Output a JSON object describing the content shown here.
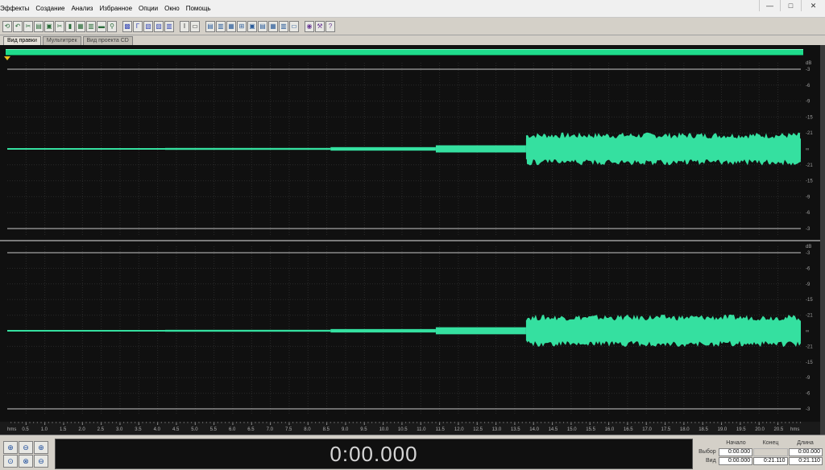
{
  "menu": [
    "Эффекты",
    "Создание",
    "Анализ",
    "Избранное",
    "Опции",
    "Окно",
    "Помощь"
  ],
  "window_controls": [
    "—",
    "□",
    "✕"
  ],
  "toolbar": {
    "groups": [
      [
        {
          "icon": "loop-icon",
          "glyph": "⟲"
        },
        {
          "icon": "undo-icon",
          "glyph": "↶"
        },
        {
          "icon": "cut-icon",
          "glyph": "✂"
        },
        {
          "icon": "copy-icon",
          "glyph": "▤"
        },
        {
          "icon": "paste-icon",
          "glyph": "▣"
        },
        {
          "icon": "razor-icon",
          "glyph": "✂"
        },
        {
          "icon": "trash-icon",
          "glyph": "▮"
        },
        {
          "icon": "mix-icon",
          "glyph": "▦"
        },
        {
          "icon": "zoom-wave-icon",
          "glyph": "▥"
        },
        {
          "icon": "save-icon",
          "glyph": "▬"
        },
        {
          "icon": "search-icon",
          "glyph": "⚲"
        }
      ],
      [
        {
          "icon": "spectral-icon",
          "glyph": "▩"
        },
        {
          "icon": "level-icon",
          "glyph": "Γ"
        },
        {
          "icon": "filter-icon",
          "glyph": "▧"
        },
        {
          "icon": "eq-icon",
          "glyph": "▨"
        },
        {
          "icon": "mixer-icon",
          "glyph": "▥"
        }
      ],
      [
        {
          "icon": "cursor-icon",
          "glyph": "I"
        },
        {
          "icon": "select-icon",
          "glyph": "▭"
        }
      ],
      [
        {
          "icon": "view-wave-icon",
          "glyph": "▤"
        },
        {
          "icon": "view-spec-icon",
          "glyph": "▥"
        },
        {
          "icon": "view-pan-icon",
          "glyph": "▦"
        },
        {
          "icon": "playlist-icon",
          "glyph": "⊞"
        },
        {
          "icon": "marker-icon",
          "glyph": "▣"
        },
        {
          "icon": "list-icon",
          "glyph": "▤"
        },
        {
          "icon": "cd-icon",
          "glyph": "▦"
        },
        {
          "icon": "meter-icon",
          "glyph": "▥"
        },
        {
          "icon": "info-icon",
          "glyph": "▭"
        }
      ],
      [
        {
          "icon": "record-icon",
          "glyph": "◉"
        },
        {
          "icon": "tools-icon",
          "glyph": "⚒"
        },
        {
          "icon": "help-icon",
          "glyph": "?"
        }
      ]
    ]
  },
  "tabs": [
    {
      "label": "Вид правки",
      "active": true
    },
    {
      "label": "Мультитрек",
      "active": false
    },
    {
      "label": "Вид проекта CD",
      "active": false
    }
  ],
  "waveform": {
    "color": "#35e0a0",
    "background": "#101010",
    "db_label": "dB",
    "db_ticks_top": [
      "-3",
      "-6",
      "-9",
      "-15",
      "-21",
      "∞",
      "-21",
      "-15",
      "-9",
      "-6",
      "-3"
    ],
    "db_ticks_bottom": [
      "-3",
      "-6",
      "-9",
      "-15",
      "-21",
      "∞",
      "-21",
      "-15",
      "-9",
      "-6",
      "-3"
    ],
    "time_unit": "hms",
    "time_ticks": [
      "0.5",
      "1.0",
      "1.5",
      "2.0",
      "2.5",
      "3.0",
      "3.5",
      "4.0",
      "4.5",
      "5.0",
      "5.5",
      "6.0",
      "6.5",
      "7.0",
      "7.5",
      "8.0",
      "8.5",
      "9.0",
      "9.5",
      "10.0",
      "10.5",
      "11.0",
      "11.5",
      "12.0",
      "12.5",
      "13.0",
      "13.5",
      "14.0",
      "14.5",
      "15.0",
      "15.5",
      "16.0",
      "16.5",
      "17.0",
      "17.5",
      "18.0",
      "18.5",
      "19.0",
      "19.5",
      "20.0",
      "20.5"
    ],
    "duration_sec": 21.11,
    "segments": [
      {
        "start": 0.0,
        "end": 4.2,
        "amplitude": 0.006
      },
      {
        "start": 4.2,
        "end": 8.6,
        "amplitude": 0.012
      },
      {
        "start": 8.6,
        "end": 11.4,
        "amplitude": 0.022
      },
      {
        "start": 11.4,
        "end": 13.8,
        "amplitude": 0.045
      },
      {
        "start": 13.8,
        "end": 21.11,
        "amplitude": 0.13
      }
    ]
  },
  "time_display": "0:00.000",
  "selection": {
    "headers": [
      "Начало",
      "Конец",
      "Длина"
    ],
    "rows": [
      {
        "label": "Выбор",
        "begin": "0:00.000",
        "end": "",
        "length": "0:00.000"
      },
      {
        "label": "Вид",
        "begin": "0:00.000",
        "end": "0:21.110",
        "length": "0:21.110"
      }
    ]
  },
  "zoom_buttons": [
    {
      "icon": "zoom-in-horizontal-icon",
      "glyph": "⊕"
    },
    {
      "icon": "zoom-out-horizontal-icon",
      "glyph": "⊖"
    },
    {
      "icon": "zoom-in-vertical-icon",
      "glyph": "⊕"
    },
    {
      "icon": "zoom-selection-icon",
      "glyph": "⊙"
    },
    {
      "icon": "zoom-out-full-icon",
      "glyph": "⊗"
    },
    {
      "icon": "zoom-out-vertical-icon",
      "glyph": "⊖"
    }
  ]
}
